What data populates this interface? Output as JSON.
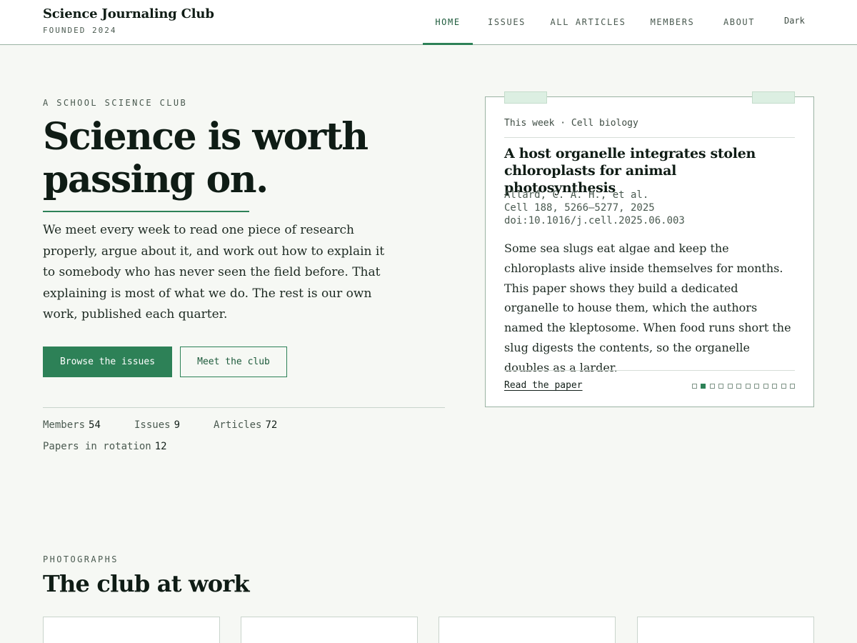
{
  "header": {
    "brand_name": "Science Journaling Club",
    "brand_sub": "FOUNDED 2024",
    "nav": [
      {
        "label": "HOME",
        "active": true
      },
      {
        "label": "ISSUES",
        "active": false
      },
      {
        "label": "ALL ARTICLES",
        "active": false
      },
      {
        "label": "MEMBERS",
        "active": false
      },
      {
        "label": "ABOUT",
        "active": false
      }
    ],
    "theme_toggle": "Dark"
  },
  "hero": {
    "eyebrow": "A SCHOOL SCIENCE CLUB",
    "title_line1": "Science is worth",
    "title_line2": "passing on.",
    "text": "We meet every week to read one piece of research properly, argue about it, and work out how to explain it to somebody who has never seen the field before. That explaining is most of what we do. The rest is our own work, published each quarter.",
    "primary_button": "Browse the issues",
    "secondary_button": "Meet the club",
    "stats": [
      {
        "label": "Members",
        "value": "54"
      },
      {
        "label": "Issues",
        "value": "9"
      },
      {
        "label": "Articles",
        "value": "72"
      },
      {
        "label": "Papers in rotation",
        "value": "12"
      }
    ]
  },
  "feature_card": {
    "kicker": "This week · Cell biology",
    "title": "A host organelle integrates stolen chloroplasts for animal photosynthesis",
    "authors": "Allard, C. A. H., et al.",
    "journal": "Cell 188, 5266–5277, 2025",
    "doi": "doi:10.1016/j.cell.2025.06.003",
    "summary": "Some sea slugs eat algae and keep the chloroplasts alive inside themselves for months. This paper shows they build a dedicated organelle to house them, which the authors named the kleptosome. When food runs short the slug digests the contents, so the organelle doubles as a larder.",
    "link": "Read the paper",
    "pager": {
      "total": 12,
      "active_index": 1
    }
  },
  "photographs": {
    "eyebrow": "PHOTOGRAPHS",
    "title": "The club at work",
    "count": 4
  },
  "colors": {
    "accent": "#2d8157",
    "background": "#f6f8f4",
    "ink": "#0f1c15"
  }
}
